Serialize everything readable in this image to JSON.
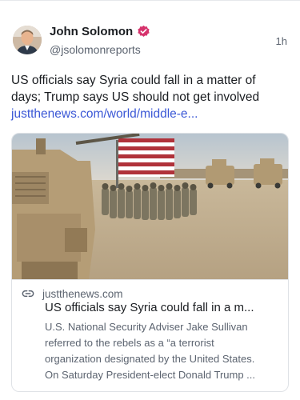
{
  "post": {
    "author_name": "John Solomon",
    "handle": "@jsolomonreports",
    "timestamp": "1h",
    "text_line1": "US officials say Syria could fall in a matter of",
    "text_line2": "days; Trump says US should not get involved",
    "link_text": "justthenews.com/world/middle-e..."
  },
  "card": {
    "domain": "justthenews.com",
    "title": "US officials say Syria could fall in a m...",
    "desc_lines": [
      "U.S. National Security Adviser Jake Sullivan",
      "referred to the rebels as a “a terrorist",
      "organization designated by the United States.",
      "On Saturday President-elect Donald Trump ..."
    ]
  },
  "icons": {
    "verified": "verified-badge-icon",
    "link": "link-icon"
  },
  "colors": {
    "verified_badge": "#d6336c",
    "link": "#3b58d6"
  }
}
